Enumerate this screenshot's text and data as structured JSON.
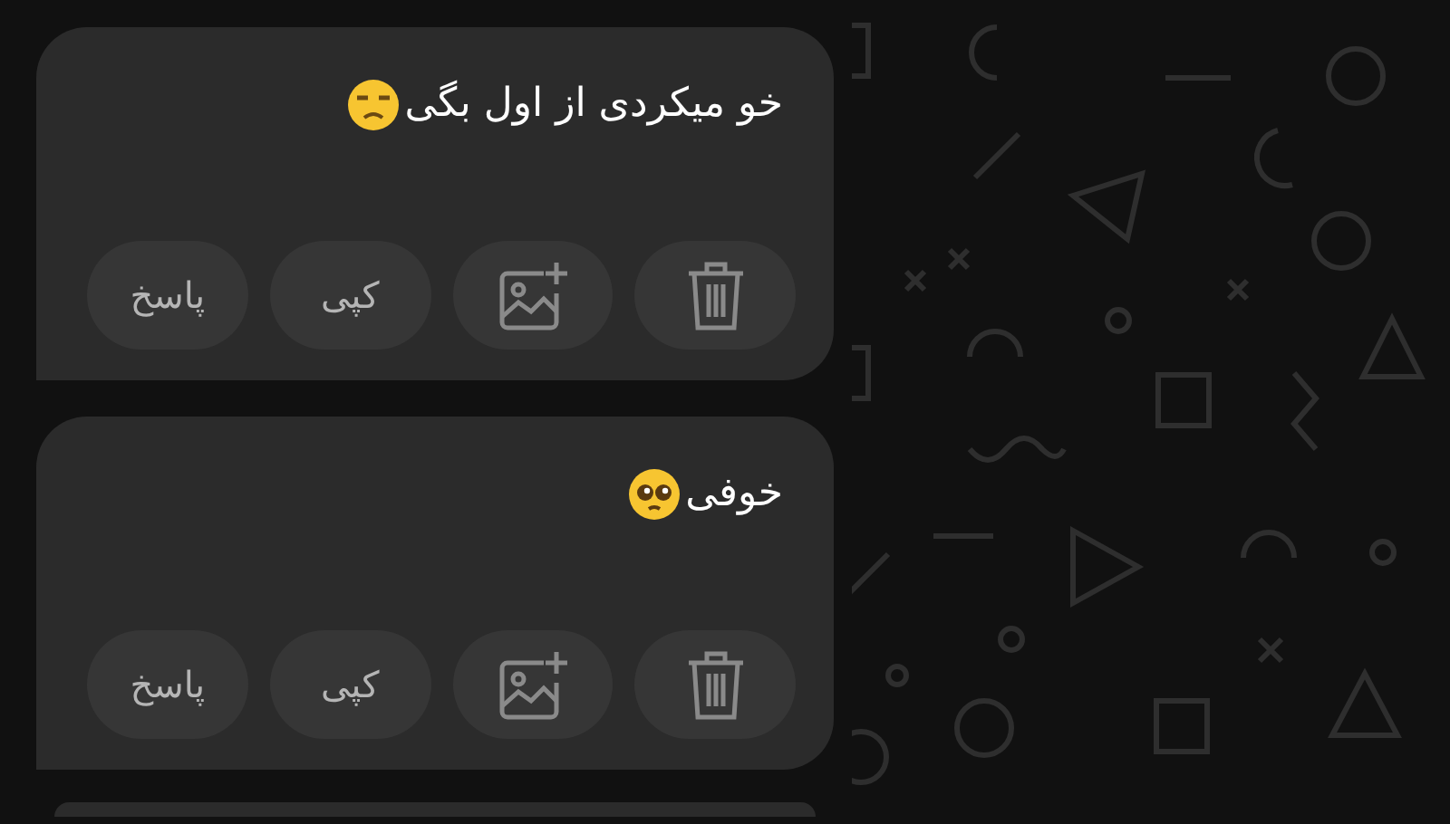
{
  "messages": [
    {
      "text": "خو میکردی از اول بگی",
      "kind": "unamused",
      "actions": [
        {
          "kind": "delete"
        },
        {
          "kind": "add-image"
        },
        {
          "kind": "text",
          "label": "کپی"
        },
        {
          "kind": "text",
          "label": "پاسخ"
        }
      ]
    },
    {
      "text": "خوفی",
      "kind": "pleading",
      "actions": [
        {
          "kind": "delete"
        },
        {
          "kind": "add-image"
        },
        {
          "kind": "text",
          "label": "کپی"
        },
        {
          "kind": "text",
          "label": "پاسخ"
        }
      ]
    }
  ]
}
